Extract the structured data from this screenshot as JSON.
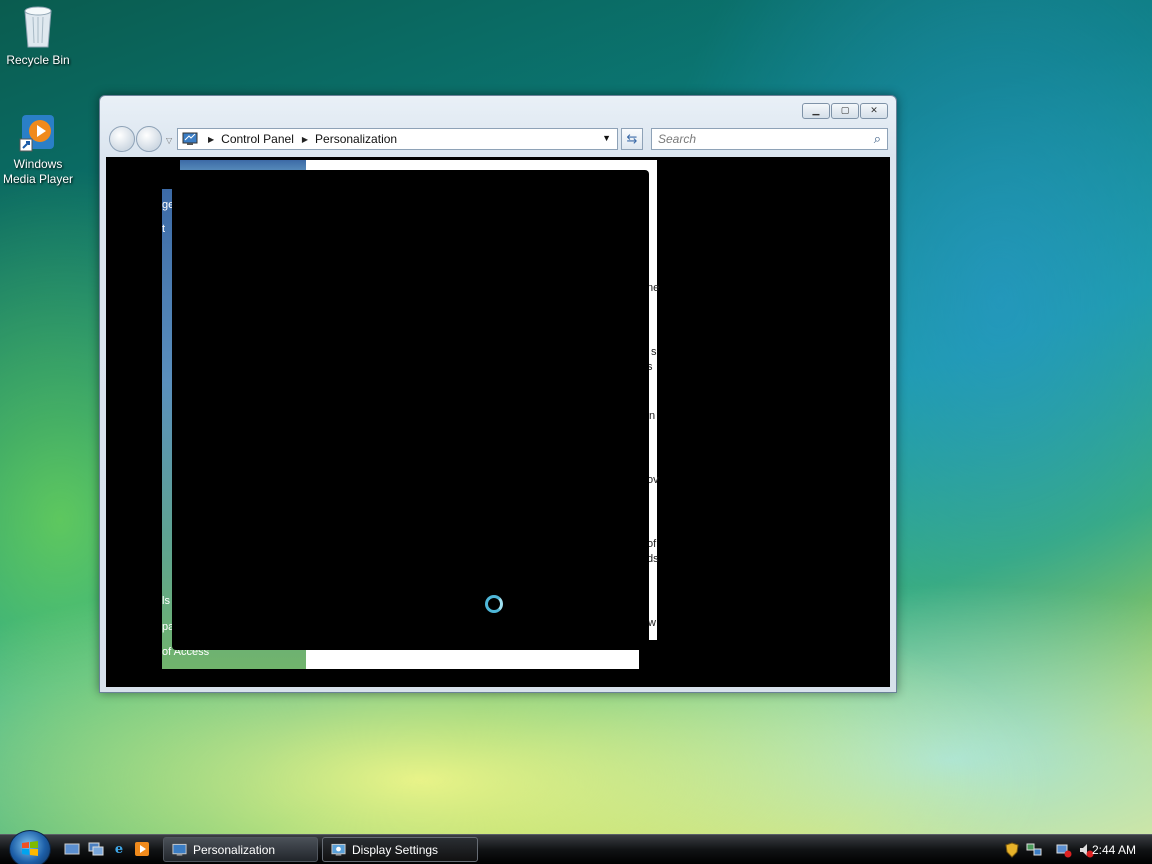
{
  "desktop": {
    "icons": [
      {
        "label": "Recycle Bin",
        "icon": "recycle-bin-icon"
      },
      {
        "label": "Windows Media Player",
        "icon": "media-player-icon"
      }
    ]
  },
  "window": {
    "breadcrumb": [
      "Control Panel",
      "Personalization"
    ],
    "search_placeholder": "Search",
    "ghost_fragments_left": [
      "ge",
      "t",
      "ls",
      "pa",
      "of Access"
    ],
    "ghost_fragments_right": [
      "ne",
      "s",
      "s",
      "n",
      "ov",
      "of",
      "ds",
      "w"
    ]
  },
  "taskbar": {
    "items": [
      {
        "label": "Personalization",
        "icon": "control-panel-icon",
        "active": false
      },
      {
        "label": "Display Settings",
        "icon": "display-settings-icon",
        "active": true
      }
    ],
    "quick_launch": [
      "show-desktop-icon",
      "switch-windows-icon",
      "internet-explorer-icon",
      "media-player-icon"
    ],
    "clock": "2:44 AM"
  },
  "colors": {
    "accent": "#3c6aa6",
    "spinner": "#4fb7d8"
  }
}
